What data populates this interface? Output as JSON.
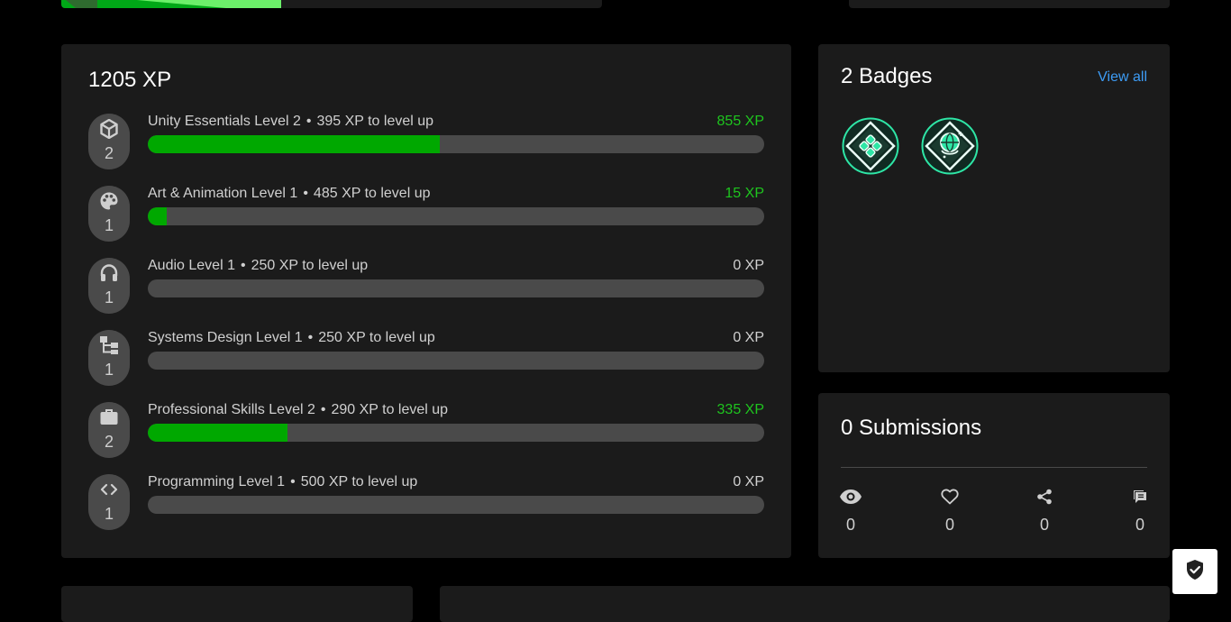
{
  "colors": {
    "background": "#000000",
    "panel": "#1b1b1b",
    "track": "#4a4a4a",
    "progress": "#00a800",
    "xp_active": "#1ec51e",
    "link": "#3d9cf5"
  },
  "xp": {
    "total": "1205 XP",
    "skills": [
      {
        "name": "Unity Essentials Level 2",
        "to_next": "395 XP to level up",
        "xp": "855 XP",
        "level": "2",
        "icon": "unity-icon",
        "progress": 0.474
      },
      {
        "name": "Art & Animation Level 1",
        "to_next": "485 XP to level up",
        "xp": "15 XP",
        "level": "1",
        "icon": "palette-icon",
        "progress": 0.03
      },
      {
        "name": "Audio Level 1",
        "to_next": "250 XP to level up",
        "xp": "0 XP",
        "level": "1",
        "icon": "headphones-icon",
        "progress": 0
      },
      {
        "name": "Systems Design Level 1",
        "to_next": "250 XP to level up",
        "xp": "0 XP",
        "level": "1",
        "icon": "hierarchy-icon",
        "progress": 0
      },
      {
        "name": "Professional Skills Level 2",
        "to_next": "290 XP to level up",
        "xp": "335 XP",
        "level": "2",
        "icon": "briefcase-icon",
        "progress": 0.227
      },
      {
        "name": "Programming Level 1",
        "to_next": "500 XP to level up",
        "xp": "0 XP",
        "level": "1",
        "icon": "code-icon",
        "progress": 0
      }
    ]
  },
  "badges": {
    "title": "2 Badges",
    "view_all": "View all",
    "items": [
      {
        "icon": "game-controller-badge-icon"
      },
      {
        "icon": "globe-badge-icon"
      }
    ]
  },
  "submissions": {
    "title": "0 Submissions",
    "stats": [
      {
        "icon": "eye-icon",
        "count": "0"
      },
      {
        "icon": "heart-icon",
        "count": "0"
      },
      {
        "icon": "share-icon",
        "count": "0"
      },
      {
        "icon": "comment-icon",
        "count": "0"
      }
    ]
  },
  "privacy": {
    "icon": "shield-check-icon"
  }
}
